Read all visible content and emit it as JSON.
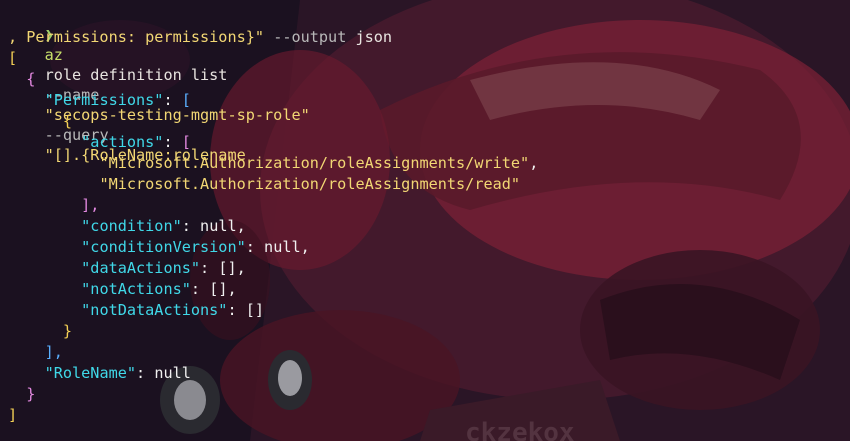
{
  "terminal": {
    "prompt_symbol": "❯",
    "command": {
      "az": "az",
      "sub": "role definition list",
      "flag_name": "--name",
      "name_value": "\"secops-testing-mgmt-sp-role\"",
      "flag_query": "--query",
      "query_line1": "\"[].{RoleName:rolename",
      "query_line2": ", Permissions: permissions}\"",
      "flag_output": "--output",
      "output_value": "json"
    },
    "output": {
      "open_array": "[",
      "open_obj": "{",
      "permissions_key": "\"Permissions\"",
      "open_perm_array": "[",
      "open_perm_obj": "{",
      "actions_key": "\"actions\"",
      "actions_open": "[",
      "action_1": "\"Microsoft.Authorization/roleAssignments/write\"",
      "action_2": "\"Microsoft.Authorization/roleAssignments/read\"",
      "actions_close": "],",
      "condition_key": "\"condition\"",
      "condition_value": "null",
      "condition_version_key": "\"conditionVersion\"",
      "condition_version_value": "null",
      "data_actions_key": "\"dataActions\"",
      "data_actions_value": "[]",
      "not_actions_key": "\"notActions\"",
      "not_actions_value": "[]",
      "not_data_actions_key": "\"notDataActions\"",
      "not_data_actions_value": "[]",
      "close_perm_obj": "}",
      "close_perm_array": "],",
      "role_name_key": "\"RoleName\"",
      "role_name_value": "null",
      "close_obj": "}",
      "close_array": "]"
    }
  }
}
